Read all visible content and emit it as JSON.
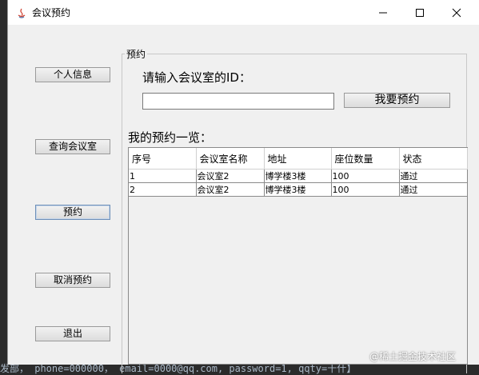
{
  "window": {
    "title": "会议预约"
  },
  "sidebar": {
    "buttons": [
      {
        "label": "个人信息"
      },
      {
        "label": "查询会议室"
      },
      {
        "label": "预约"
      },
      {
        "label": "取消预约"
      },
      {
        "label": "退出"
      }
    ]
  },
  "booking": {
    "group_title": "预约",
    "prompt": "请输入会议室的ID：",
    "id_value": "",
    "submit_label": "我要预约",
    "list_title": "我的预约一览："
  },
  "table": {
    "columns": [
      "序号",
      "会议室名称",
      "地址",
      "座位数量",
      "状态"
    ],
    "rows": [
      [
        "1",
        "会议室2",
        "博学楼3楼",
        "100",
        "通过"
      ],
      [
        "2",
        "会议室2",
        "博学楼3楼",
        "100",
        "通过"
      ]
    ]
  },
  "background": {
    "console_line": "发部， phone=000000， email=0000@qq.com, password=1, qqty=十什】"
  },
  "watermark": "@稀土掘金技术社区"
}
